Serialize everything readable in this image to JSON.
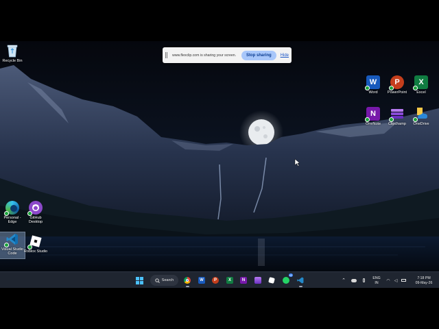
{
  "share_bar": {
    "message": "www.flexclip.com is sharing your screen.",
    "stop_label": "Stop sharing",
    "hide_label": "Hide"
  },
  "desktop_left": [
    {
      "label": "Recycle Bin",
      "icon": "recycle-bin-icon"
    },
    {
      "label": "Personal - Edge",
      "icon": "edge-icon"
    },
    {
      "label": "GitHub Desktop",
      "icon": "github-icon"
    },
    {
      "label": "Visual Studio Code",
      "icon": "vscode-icon"
    },
    {
      "label": "Roblox Studio",
      "icon": "roblox-icon"
    }
  ],
  "desktop_right": [
    {
      "label": "Word",
      "icon": "word-icon",
      "letter": "W",
      "color": "#185abd"
    },
    {
      "label": "PowerPoint",
      "icon": "powerpoint-icon",
      "letter": "P",
      "color": "#c43e1c"
    },
    {
      "label": "Excel",
      "icon": "excel-icon",
      "letter": "X",
      "color": "#107c41"
    },
    {
      "label": "OneNote",
      "icon": "onenote-icon",
      "letter": "N",
      "color": "#7719aa"
    },
    {
      "label": "Clipchamp",
      "icon": "clipchamp-icon",
      "color": "#8a4bd8"
    },
    {
      "label": "OneDrive",
      "icon": "onedrive-icon",
      "color": "#0f6cbd"
    }
  ],
  "taskbar": {
    "search_label": "Search",
    "language": "ENG",
    "region": "IN",
    "time": "7:18 PM",
    "date": "09-May-26",
    "whatsapp_badge": "42"
  }
}
